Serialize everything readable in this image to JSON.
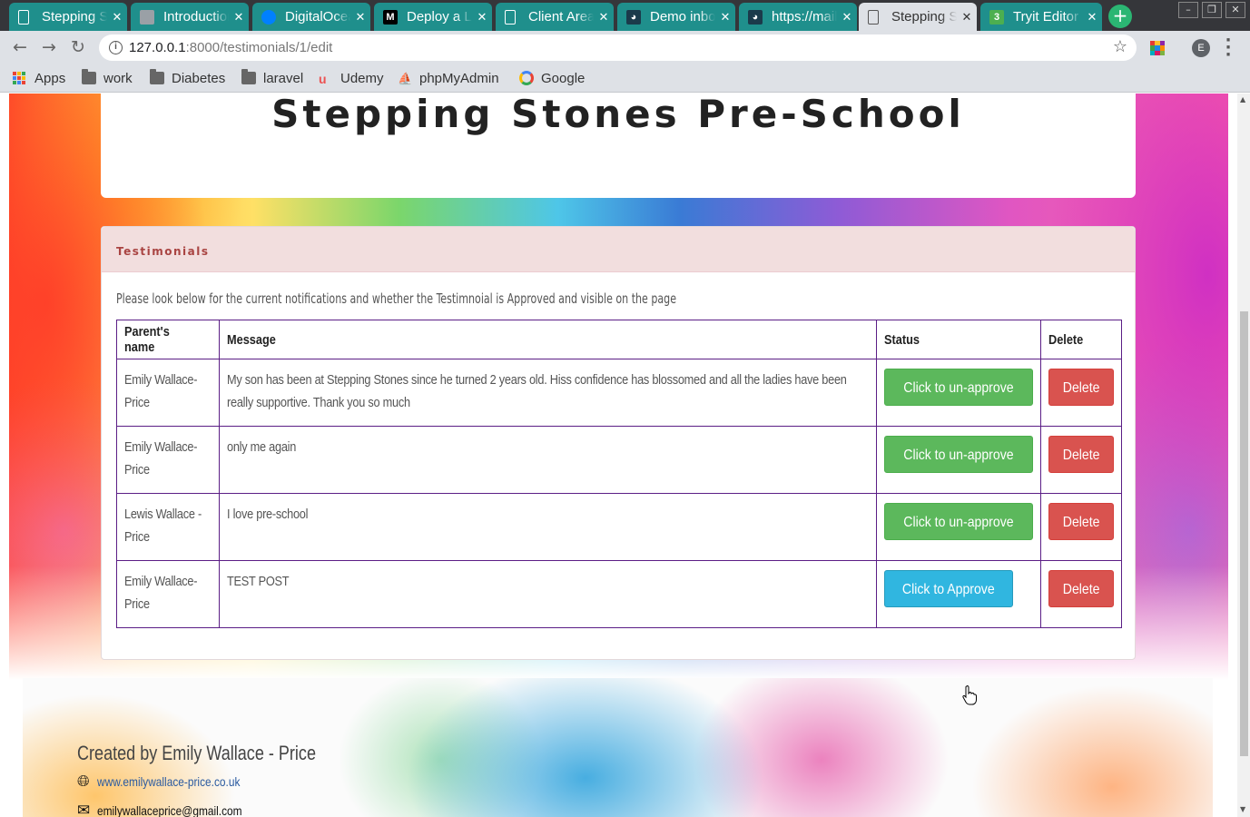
{
  "browser": {
    "tabs": [
      {
        "title": "Stepping Stones",
        "icon": "doc-icon",
        "active": false
      },
      {
        "title": "Introduction",
        "icon": "image-icon",
        "active": false
      },
      {
        "title": "DigitalOcean",
        "icon": "digitalocean-icon",
        "active": false
      },
      {
        "title": "Deploy a Laravel",
        "icon": "medium-icon",
        "active": false
      },
      {
        "title": "Client Area",
        "icon": "doc-icon",
        "active": false
      },
      {
        "title": "Demo inbox",
        "icon": "mailtrap-icon",
        "active": false
      },
      {
        "title": "https://mailtrap",
        "icon": "mailtrap-icon",
        "active": false
      },
      {
        "title": "Stepping Stones",
        "icon": "doc-icon",
        "active": true
      },
      {
        "title": "Tryit Editor",
        "icon": "w3schools-icon",
        "active": false
      }
    ],
    "url_host": "127.0.0.1",
    "url_path": ":8000/testimonials/1/edit",
    "profile_initial": "E",
    "bookmarks": [
      {
        "label": "Apps",
        "icon": "apps-grid-icon"
      },
      {
        "label": "work",
        "icon": "folder-icon"
      },
      {
        "label": "Diabetes",
        "icon": "folder-icon"
      },
      {
        "label": "laravel",
        "icon": "folder-icon"
      },
      {
        "label": "Udemy",
        "icon": "udemy-icon"
      },
      {
        "label": "phpMyAdmin",
        "icon": "phpmyadmin-icon"
      },
      {
        "label": "Google",
        "icon": "google-icon"
      }
    ]
  },
  "site": {
    "title": "Stepping Stones Pre-School"
  },
  "panel": {
    "heading": "Testimonials",
    "intro": "Please look below for the current notifications and whether the Testimnoial is Approved and visible on the page",
    "columns": [
      "Parent's name",
      "Message",
      "Status",
      "Delete"
    ],
    "rows": [
      {
        "parent": "Emily Wallace-Price",
        "message": "My son has been at Stepping Stones since he turned 2 years old. Hiss confidence has blossomed and all the ladies have been really supportive. Thank you so much",
        "status_label": "Click to un-approve",
        "status": "approved",
        "delete_label": "Delete"
      },
      {
        "parent": "Emily Wallace-Price",
        "message": "only me again",
        "status_label": "Click to un-approve",
        "status": "approved",
        "delete_label": "Delete"
      },
      {
        "parent": "Lewis Wallace - Price",
        "message": "I love pre-school",
        "status_label": "Click to un-approve",
        "status": "approved",
        "delete_label": "Delete"
      },
      {
        "parent": "Emily Wallace-Price",
        "message": "TEST POST",
        "status_label": "Click to Approve",
        "status": "pending",
        "delete_label": "Delete"
      }
    ]
  },
  "footer": {
    "created_by": "Created by Emily Wallace - Price",
    "website": "www.emilywallace-price.co.uk",
    "email": "emilywallaceprice@gmail.com",
    "website_icon": "globe-icon",
    "email_icon": "envelope-icon"
  },
  "colors": {
    "approve_green": "#5cb85c",
    "approve_blue": "#30b6e0",
    "delete_red": "#d9534f",
    "panel_heading_bg": "#f2dede",
    "panel_heading_text": "#a94442",
    "table_border": "#5b1e86",
    "tab_teal": "#1f8f8c"
  }
}
